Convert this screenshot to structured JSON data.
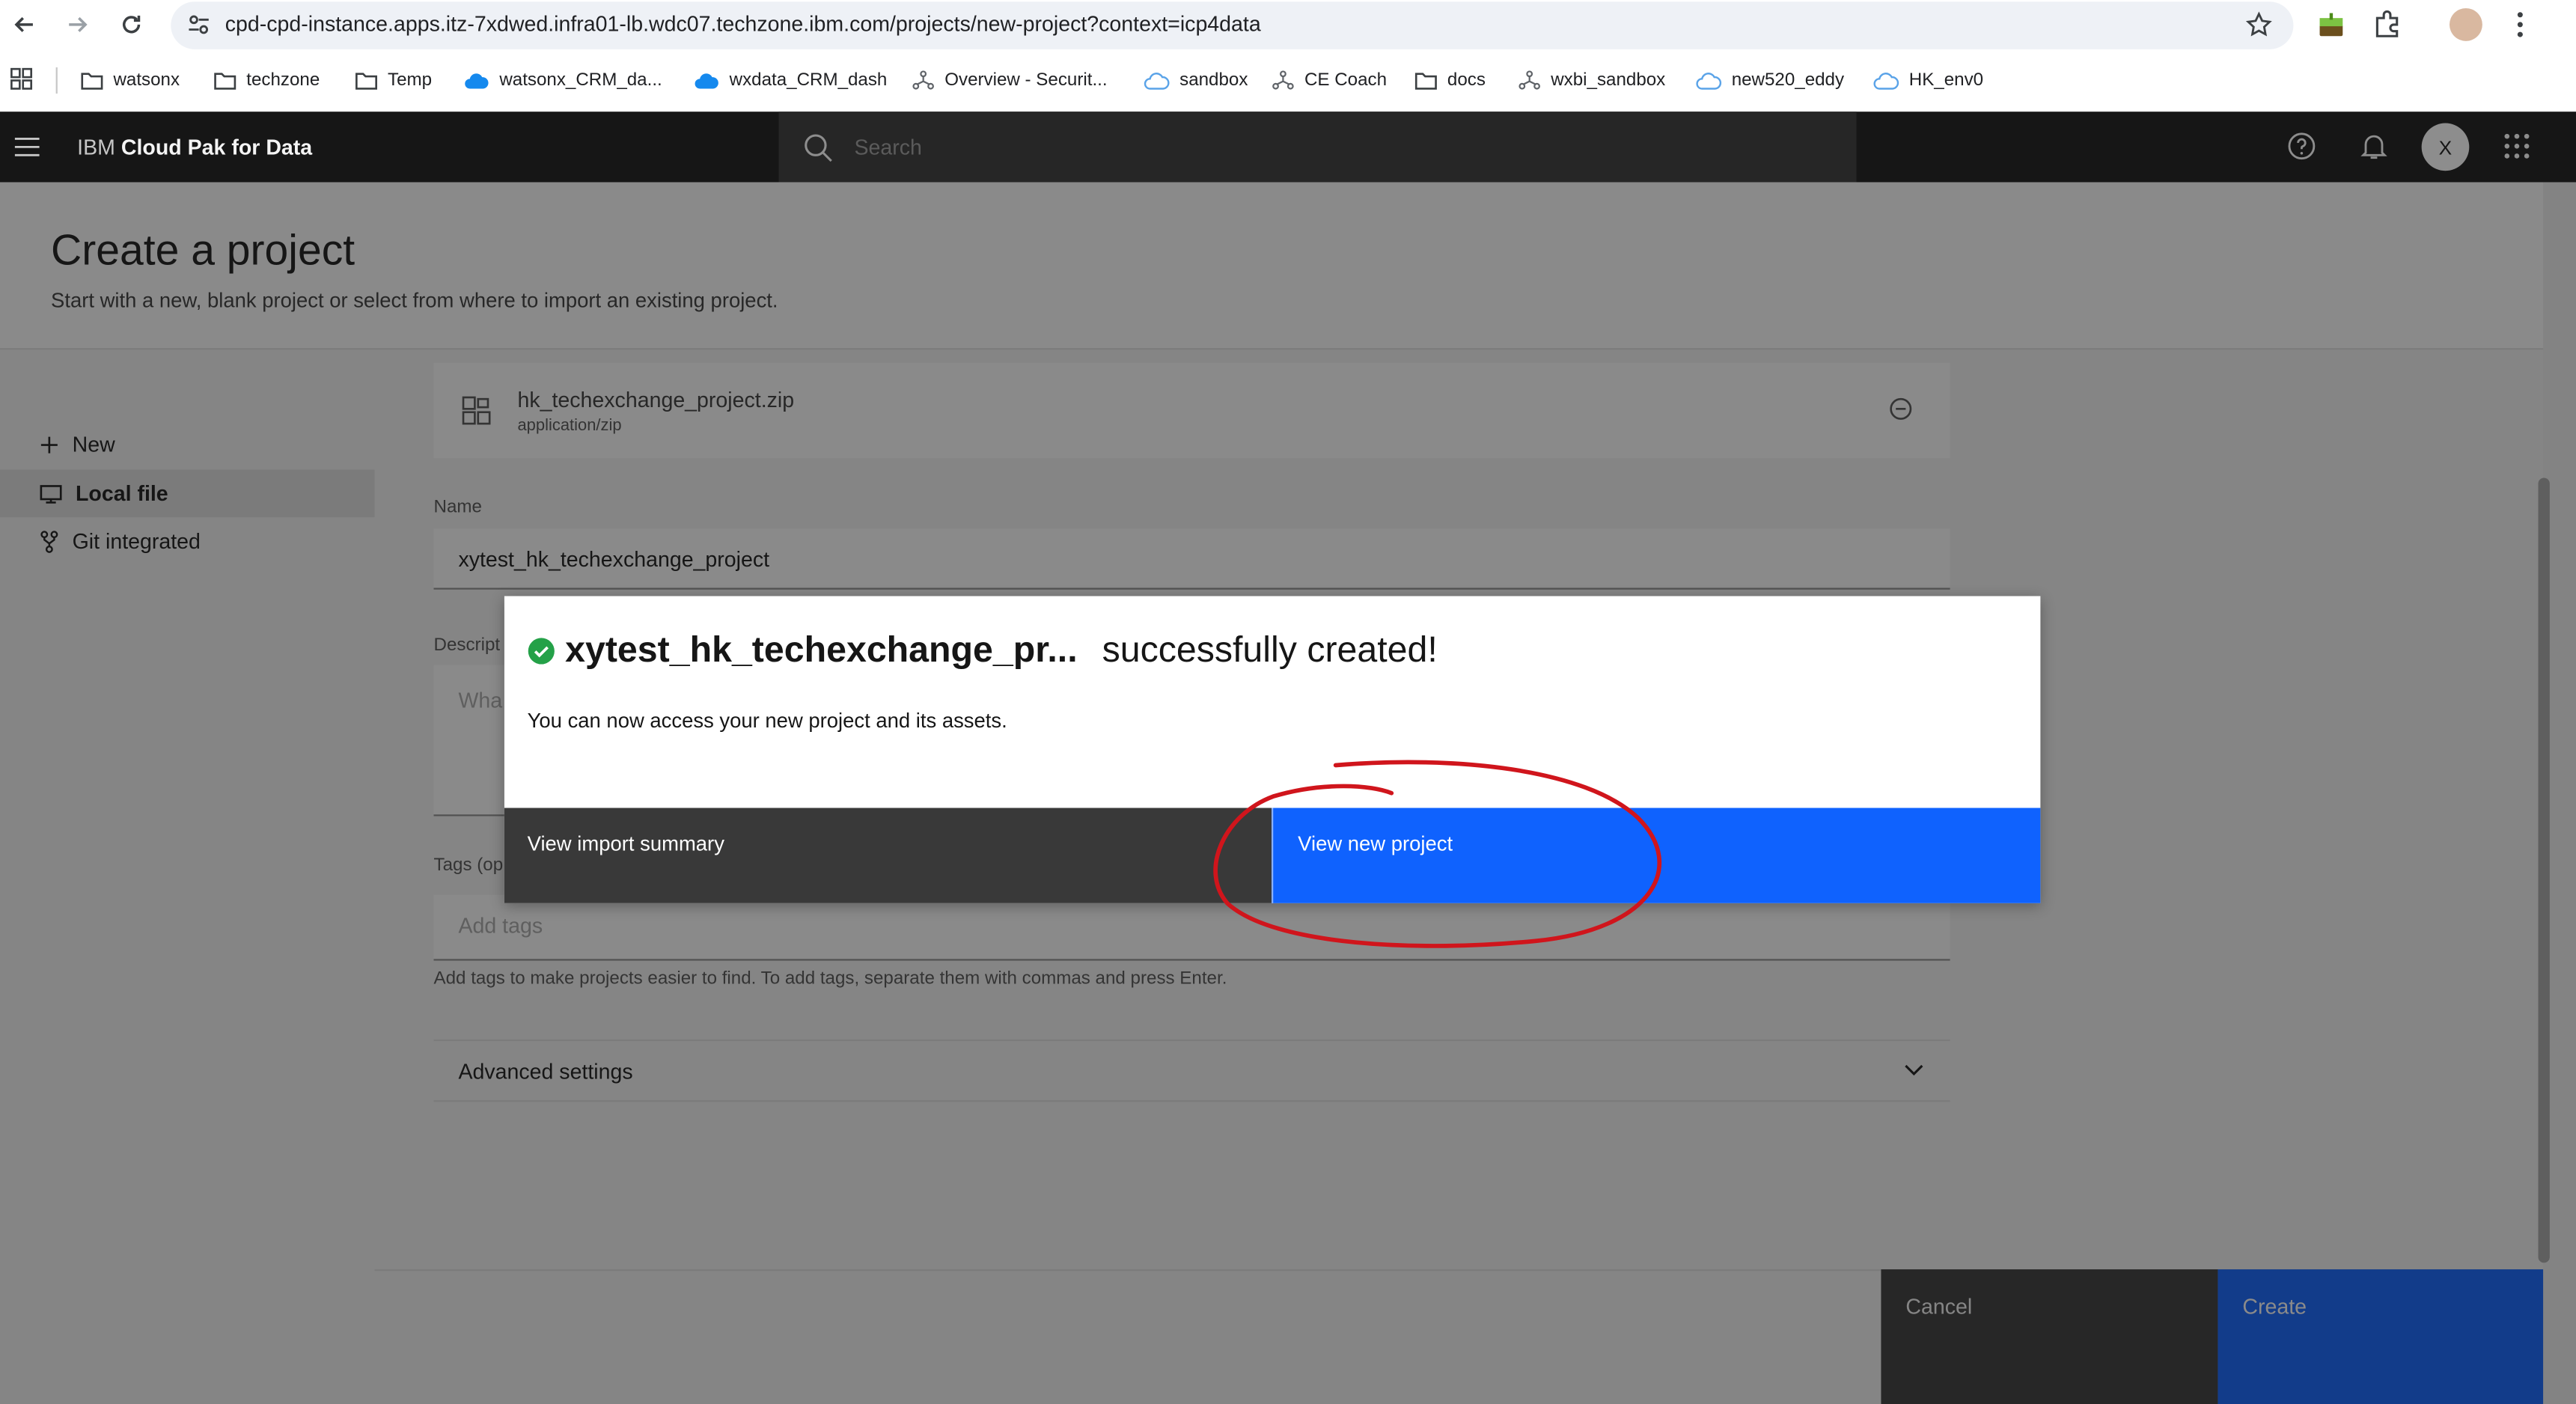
{
  "browser": {
    "url": "cpd-cpd-instance.apps.itz-7xdwed.infra01-lb.wdc07.techzone.ibm.com/projects/new-project?context=icp4data",
    "bookmarks": [
      {
        "label": "watsonx",
        "icon": "folder-icon"
      },
      {
        "label": "techzone",
        "icon": "folder-icon"
      },
      {
        "label": "Temp",
        "icon": "folder-icon"
      },
      {
        "label": "watsonx_CRM_da...",
        "icon": "cloud-icon"
      },
      {
        "label": "wxdata_CRM_dash",
        "icon": "cloud-icon"
      },
      {
        "label": "Overview - Securit...",
        "icon": "network-icon"
      },
      {
        "label": "sandbox",
        "icon": "cloud-outline-icon"
      },
      {
        "label": "CE Coach",
        "icon": "network-icon"
      },
      {
        "label": "docs",
        "icon": "folder-icon"
      },
      {
        "label": "wxbi_sandbox",
        "icon": "network-icon"
      },
      {
        "label": "new520_eddy",
        "icon": "cloud-outline-icon"
      },
      {
        "label": "HK_env0",
        "icon": "cloud-outline-icon"
      }
    ]
  },
  "header": {
    "brand_prefix": "IBM",
    "brand_name": "Cloud Pak for Data",
    "search_placeholder": "Search",
    "avatar_initial": "X"
  },
  "page": {
    "title": "Create a project",
    "subtitle": "Start with a new, blank project or select from where to import an existing project."
  },
  "nav": {
    "items": [
      {
        "label": "New",
        "icon": "plus-icon",
        "active": false
      },
      {
        "label": "Local file",
        "icon": "desktop-icon",
        "active": true
      },
      {
        "label": "Git integrated",
        "icon": "branch-icon",
        "active": false
      }
    ]
  },
  "form": {
    "file_name": "hk_techexchange_project.zip",
    "file_type": "application/zip",
    "name_label": "Name",
    "name_value": "xytest_hk_techexchange_project",
    "description_label_partial": "Descript",
    "description_placeholder_partial": "Wha",
    "tags_label_partial": "Tags (op",
    "tags_placeholder": "Add tags",
    "tags_helper": "Add tags to make projects easier to find. To add tags, separate them with commas and press Enter.",
    "advanced_label": "Advanced settings"
  },
  "footer": {
    "cancel": "Cancel",
    "create": "Create"
  },
  "modal": {
    "project_name": "xytest_hk_techexchange_pr...",
    "title_suffix": "successfully created!",
    "body": "You can now access your new project and its assets.",
    "secondary_button": "View import summary",
    "primary_button": "View new project"
  },
  "colors": {
    "primary": "#0f62fe",
    "header": "#161616",
    "success": "#24a148",
    "annotation": "#d0151c"
  }
}
